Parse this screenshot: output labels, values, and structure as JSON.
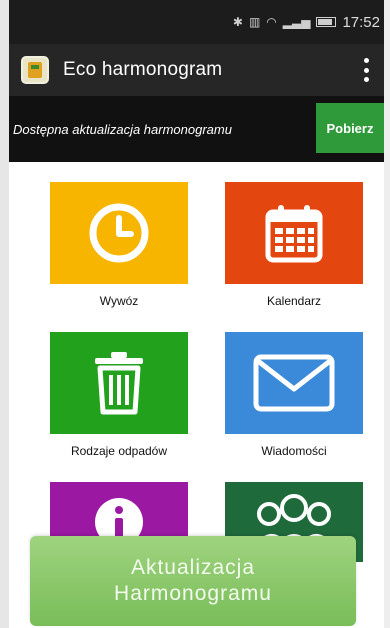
{
  "status_bar": {
    "time": "17:52"
  },
  "app_bar": {
    "title": "Eco harmonogram",
    "menu_icon": "overflow-menu-icon"
  },
  "update_banner": {
    "text": "Dostępna aktualizacja harmonogramu",
    "button_label": "Pobierz"
  },
  "tiles": [
    {
      "label": "Wywóz",
      "icon": "clock-icon",
      "color": "#f7b500"
    },
    {
      "label": "Kalendarz",
      "icon": "calendar-icon",
      "color": "#e4460f"
    },
    {
      "label": "Rodzaje odpadów",
      "icon": "trash-icon",
      "color": "#22a11c"
    },
    {
      "label": "Wiadomości",
      "icon": "envelope-icon",
      "color": "#3a8ad9"
    },
    {
      "label": "",
      "icon": "info-icon",
      "color": "#9b18a3"
    },
    {
      "label": "",
      "icon": "people-icon",
      "color": "#1f6a3b"
    }
  ],
  "cta": {
    "line1": "Aktualizacja",
    "line2": "Harmonogramu"
  },
  "colors": {
    "accent_green": "#2f9a3a",
    "cta_green": "#8cc96b",
    "app_bar": "#262626"
  }
}
